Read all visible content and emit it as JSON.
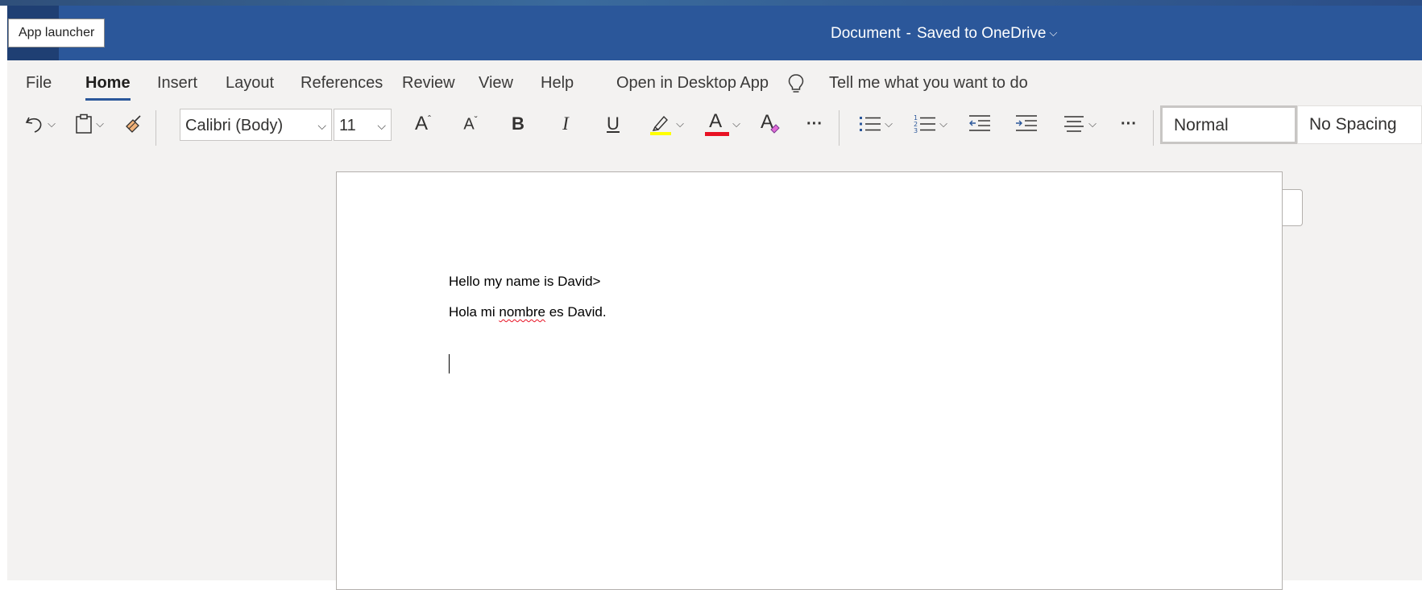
{
  "titlebar": {
    "app_launcher_tooltip": "App launcher",
    "doc_name": "Document",
    "separator": "-",
    "save_status": "Saved to OneDrive",
    "chevron": "⌵"
  },
  "tabs": [
    {
      "label": "File"
    },
    {
      "label": "Home",
      "active": true
    },
    {
      "label": "Insert"
    },
    {
      "label": "Layout"
    },
    {
      "label": "References"
    },
    {
      "label": "Review"
    },
    {
      "label": "View"
    },
    {
      "label": "Help"
    },
    {
      "label": "Open in Desktop App"
    }
  ],
  "tell_me": {
    "icon": "lightbulb-icon",
    "label": "Tell me what you want to do"
  },
  "toolbar": {
    "font_name": "Calibri (Body)",
    "font_size": "11",
    "grow_font_glyph": "A",
    "shrink_font_glyph": "A",
    "bold_glyph": "B",
    "italic_glyph": "I",
    "underline_glyph": "U",
    "font_color_glyph": "A",
    "clear_format_glyph": "A",
    "more_glyph": "···",
    "highlight_color": "#ffff00",
    "font_color": "#e81123",
    "styles": [
      "Normal",
      "No Spacing"
    ]
  },
  "document": {
    "paragraphs": [
      "Hello my name is David>"
    ],
    "second_para_before": "Hola mi ",
    "second_para_misspelled": "nombre",
    "second_para_after": " es David."
  },
  "colors": {
    "brand": "#2b579a",
    "ribbon_bg": "#f3f2f1"
  }
}
